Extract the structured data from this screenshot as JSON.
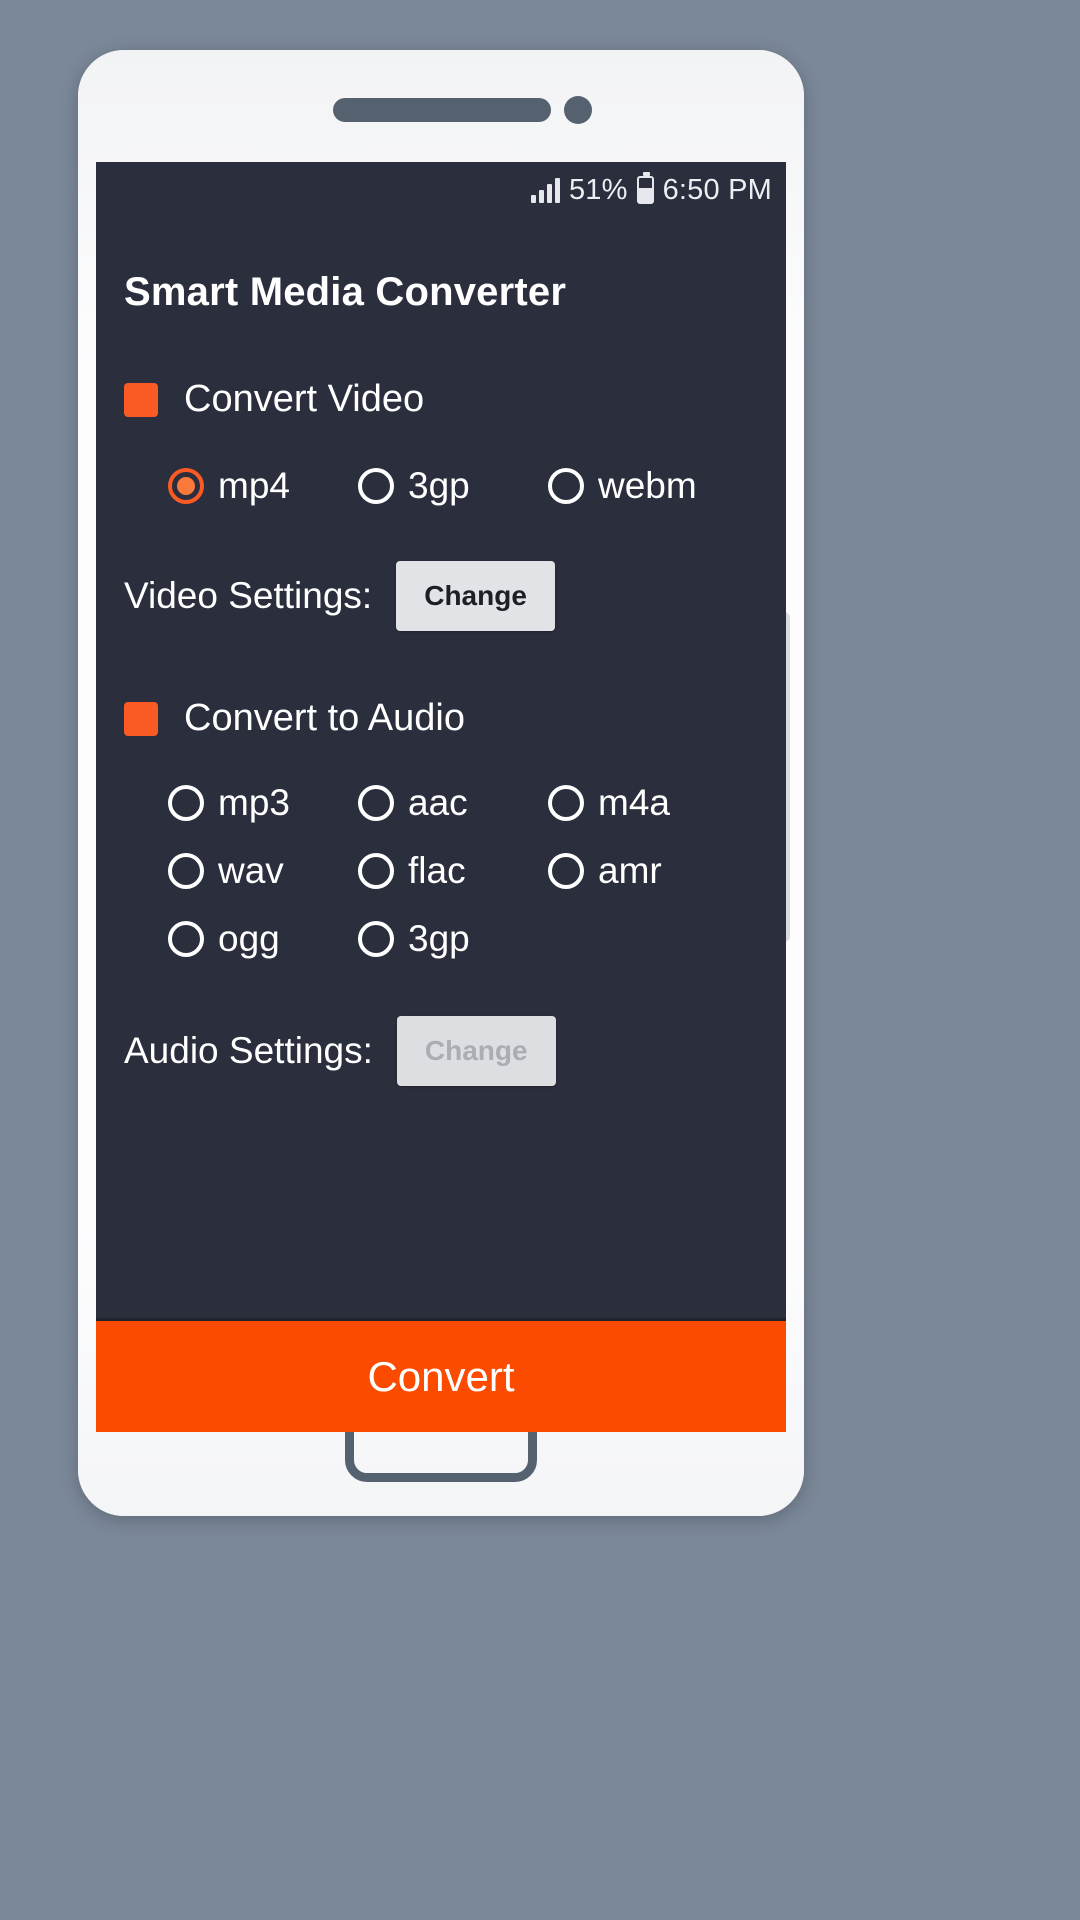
{
  "status_bar": {
    "signal_icon": "signal-bars-icon",
    "battery_percent": "51%",
    "battery_icon": "battery-icon",
    "time": "6:50 PM"
  },
  "app": {
    "title": "Smart Media Converter",
    "accent_color": "#fa5a23",
    "convert_bar_color": "#fa4b00",
    "screen_background": "#2b2e3d"
  },
  "video_section": {
    "checkbox_label": "Convert Video",
    "checkbox_checked": true,
    "formats": [
      {
        "label": "mp4",
        "selected": true
      },
      {
        "label": "3gp",
        "selected": false
      },
      {
        "label": "webm",
        "selected": false
      }
    ],
    "settings_label": "Video Settings:",
    "settings_button": "Change",
    "settings_button_enabled": true
  },
  "audio_section": {
    "checkbox_label": "Convert to Audio",
    "checkbox_checked": true,
    "format_rows": [
      [
        {
          "label": "mp3",
          "selected": false
        },
        {
          "label": "aac",
          "selected": false
        },
        {
          "label": "m4a",
          "selected": false
        }
      ],
      [
        {
          "label": "wav",
          "selected": false
        },
        {
          "label": "flac",
          "selected": false
        },
        {
          "label": "amr",
          "selected": false
        }
      ],
      [
        {
          "label": "ogg",
          "selected": false
        },
        {
          "label": "3gp",
          "selected": false
        }
      ]
    ],
    "settings_label": "Audio Settings:",
    "settings_button": "Change",
    "settings_button_enabled": false
  },
  "convert_button": {
    "label": "Convert"
  }
}
